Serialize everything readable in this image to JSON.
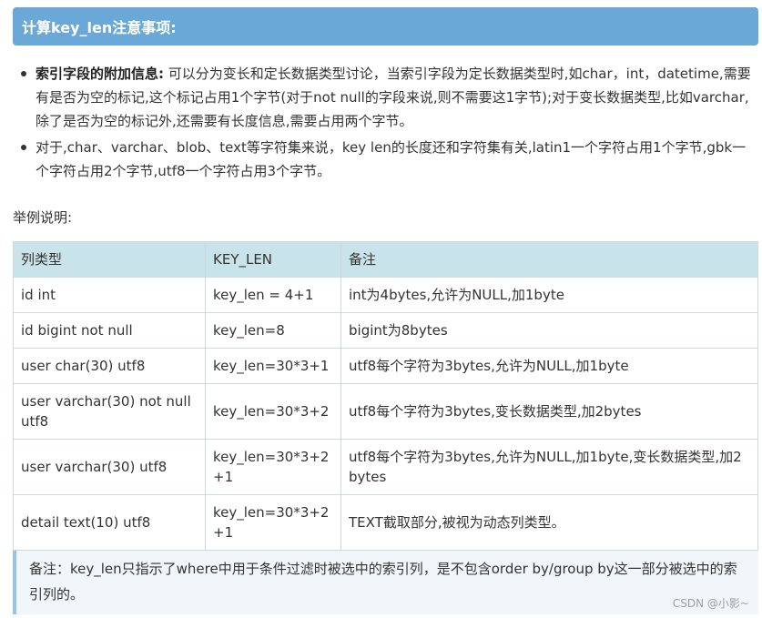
{
  "header": {
    "title": "计算key_len注意事项:"
  },
  "bullets": [
    {
      "strong": "索引字段的附加信息:",
      "text": " 可以分为变长和定长数据类型讨论，当索引字段为定长数据类型时,如char，int，datetime,需要有是否为空的标记,这个标记占用1个字节(对于not null的字段来说,则不需要这1字节);对于变长数据类型,比如varchar,除了是否为空的标记外,还需要有长度信息,需要占用两个字节。"
    },
    {
      "strong": "",
      "text": "对于,char、varchar、blob、text等字符集来说，key len的长度还和字符集有关,latin1一个字符占用1个字节,gbk一个字符占用2个字节,utf8一个字符占用3个字节。"
    }
  ],
  "example_label": "举例说明:",
  "table": {
    "headers": [
      "列类型",
      "KEY_LEN",
      "备注"
    ],
    "rows": [
      [
        "id int",
        "key_len = 4+1",
        "int为4bytes,允许为NULL,加1byte"
      ],
      [
        "id bigint not null",
        "key_len=8",
        "bigint为8bytes"
      ],
      [
        "user char(30) utf8",
        "key_len=30*3+1",
        "utf8每个字符为3bytes,允许为NULL,加1byte"
      ],
      [
        "user varchar(30) not null utf8",
        "key_len=30*3+2",
        "utf8每个字符为3bytes,变长数据类型,加2bytes"
      ],
      [
        "user varchar(30) utf8",
        "key_len=30*3+2+1",
        "utf8每个字符为3bytes,允许为NULL,加1byte,变长数据类型,加2bytes"
      ],
      [
        "detail text(10) utf8",
        "key_len=30*3+2+1",
        "TEXT截取部分,被视为动态列类型。"
      ]
    ]
  },
  "note": "备注：key_len只指示了where中用于条件过滤时被选中的索引列，是不包含order by/group by这一部分被选中的索引列的。",
  "watermark": "CSDN @小影~",
  "colors": {
    "header_bg": "#6aa8d8",
    "table_header_bg": "#c9e3ea",
    "note_bg": "#f1f6fb",
    "note_border": "#9cc3e6"
  }
}
